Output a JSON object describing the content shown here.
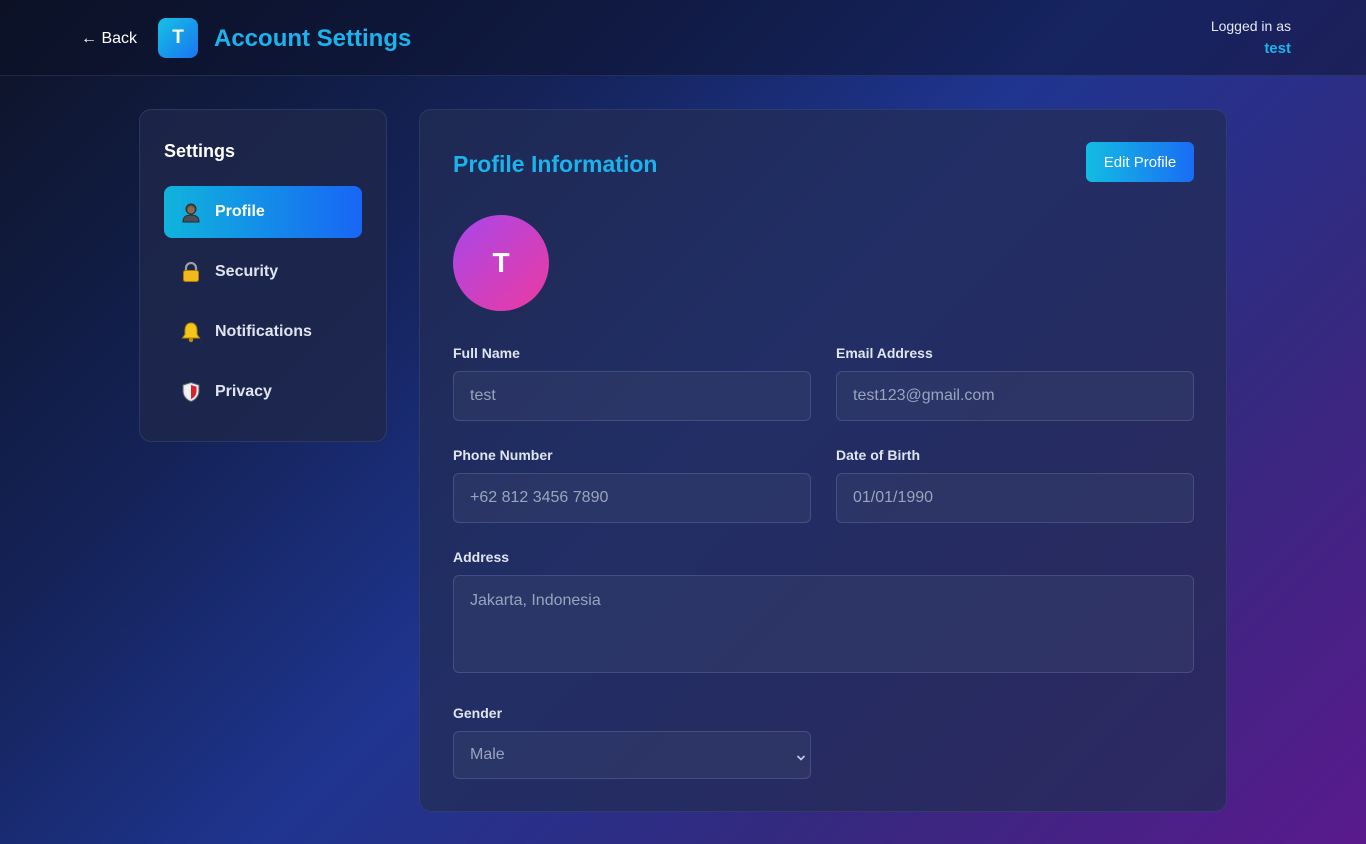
{
  "header": {
    "back_label": "← Back",
    "logo_letter": "T",
    "title": "Account Settings",
    "logged_in_label": "Logged in as",
    "username": "test"
  },
  "sidebar": {
    "title": "Settings",
    "items": [
      {
        "label": "Profile",
        "icon": "person-icon",
        "active": true
      },
      {
        "label": "Security",
        "icon": "lock-icon",
        "active": false
      },
      {
        "label": "Notifications",
        "icon": "bell-icon",
        "active": false
      },
      {
        "label": "Privacy",
        "icon": "shield-icon",
        "active": false
      }
    ]
  },
  "profile": {
    "title": "Profile Information",
    "edit_button": "Edit Profile",
    "avatar_letter": "T",
    "fields": {
      "full_name": {
        "label": "Full Name",
        "value": "test"
      },
      "email": {
        "label": "Email Address",
        "value": "test123@gmail.com"
      },
      "phone": {
        "label": "Phone Number",
        "value": "+62 812 3456 7890"
      },
      "dob": {
        "label": "Date of Birth",
        "value": "01/01/1990"
      },
      "address": {
        "label": "Address",
        "value": "Jakarta, Indonesia"
      },
      "gender": {
        "label": "Gender",
        "value": "Male"
      }
    }
  },
  "colors": {
    "accent": "#1cb2ec",
    "active_gradient_start": "#10b4dc",
    "active_gradient_end": "#1866f5",
    "avatar_gradient_start": "#a847ea",
    "avatar_gradient_end": "#ec3aa0"
  }
}
